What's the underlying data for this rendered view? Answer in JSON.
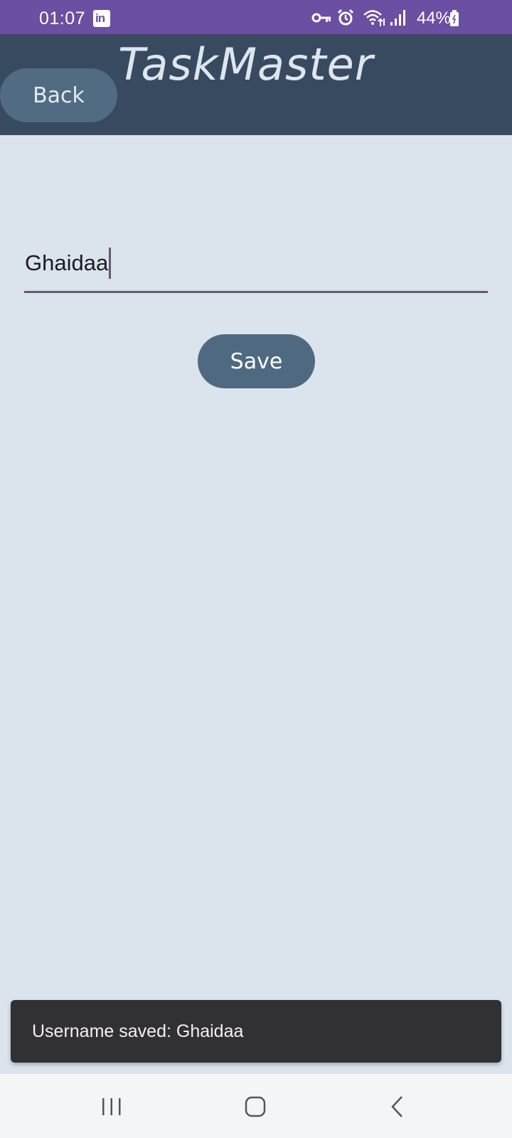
{
  "status_bar": {
    "time": "01:07",
    "notification_icon": "linkedin-icon",
    "notification_icon_text": "in",
    "icons": [
      "key-icon",
      "alarm-icon",
      "wifi-icon",
      "signal-icon",
      "battery-icon"
    ],
    "battery": "44%",
    "color": "#6a4fa2"
  },
  "app_bar": {
    "title": "TaskMaster",
    "back_label": "Back",
    "color": "#384a5f"
  },
  "form": {
    "username_value": "Ghaidaa",
    "save_label": "Save",
    "button_color": "#4f6980"
  },
  "snackbar": {
    "message": "Username saved: Ghaidaa"
  },
  "nav_bar": {
    "buttons": [
      "recents-icon",
      "home-icon",
      "back-icon"
    ]
  },
  "colors": {
    "background": "#dbe3ec",
    "accent": "#625b71"
  }
}
